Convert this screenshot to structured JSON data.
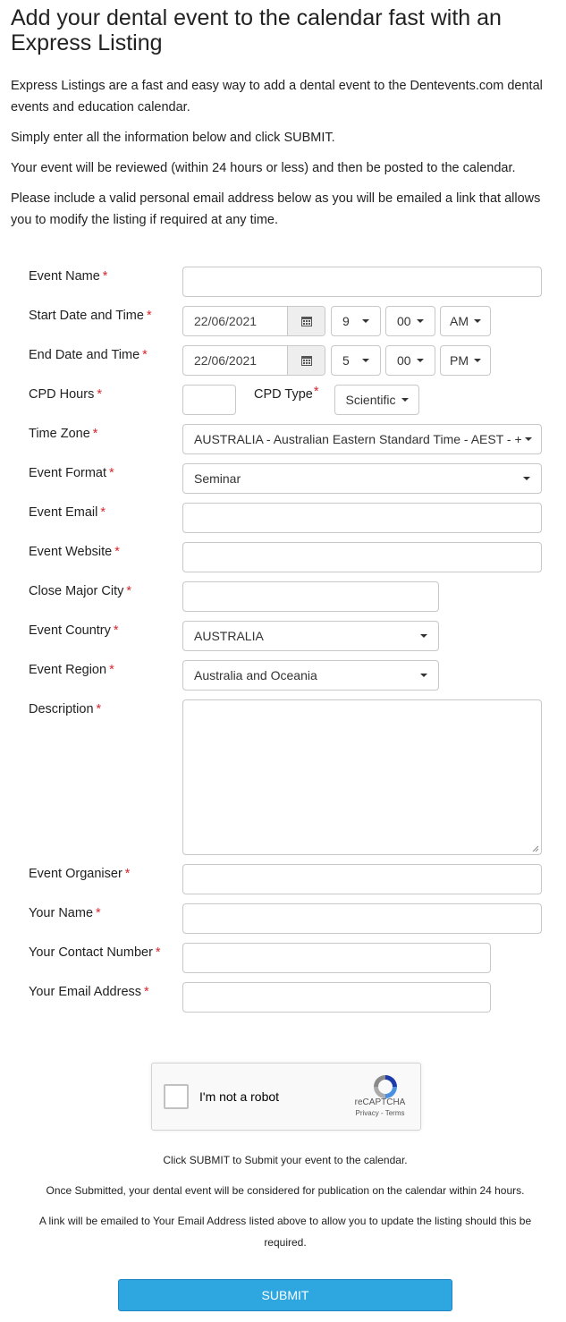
{
  "page": {
    "title": "Add your dental event to the calendar fast with an Express Listing",
    "intro": [
      "Express Listings are a fast and easy way to add a dental event to the Dentevents.com dental events and education calendar.",
      "Simply enter all the information below and click SUBMIT.",
      "Your event will be reviewed (within 24 hours or less) and then be posted to the calendar.",
      "Please include a valid personal email address below as you will be emailed a link that allows you to modify the listing if required at any time."
    ]
  },
  "form": {
    "required_mark": "*",
    "labels": {
      "event_name": "Event Name",
      "start": "Start Date and Time",
      "end": "End Date and Time",
      "cpd_hours": "CPD Hours",
      "cpd_type": "CPD Type",
      "time_zone": "Time Zone",
      "event_format": "Event Format",
      "event_email": "Event Email",
      "event_website": "Event Website",
      "close_major_city": "Close Major City",
      "event_country": "Event Country",
      "event_region": "Event Region",
      "description": "Description",
      "event_organiser": "Event Organiser",
      "your_name": "Your Name",
      "contact_number": "Your Contact Number",
      "email_address": "Your Email Address"
    },
    "values": {
      "start_date": "22/06/2021",
      "start_hour": "9",
      "start_minute": "00",
      "start_ampm": "AM",
      "end_date": "22/06/2021",
      "end_hour": "5",
      "end_minute": "00",
      "end_ampm": "PM",
      "cpd_type": "Scientific",
      "time_zone": "AUSTRALIA - Australian Eastern Standard Time - AEST - +",
      "event_format": "Seminar",
      "event_country": "AUSTRALIA",
      "event_region": "Australia and Oceania"
    }
  },
  "captcha": {
    "label": "I'm not a robot",
    "brand": "reCAPTCHA",
    "links": "Privacy - Terms"
  },
  "notes": [
    "Click SUBMIT to Submit your event to the calendar.",
    "Once Submitted, your dental event will be considered for publication on the calendar within 24 hours.",
    "A link will be emailed to Your Email Address listed above to allow you to update the listing should this be required."
  ],
  "submit_label": "SUBMIT",
  "colors": {
    "required": "#d9262c",
    "submit": "#2ea7e0"
  }
}
